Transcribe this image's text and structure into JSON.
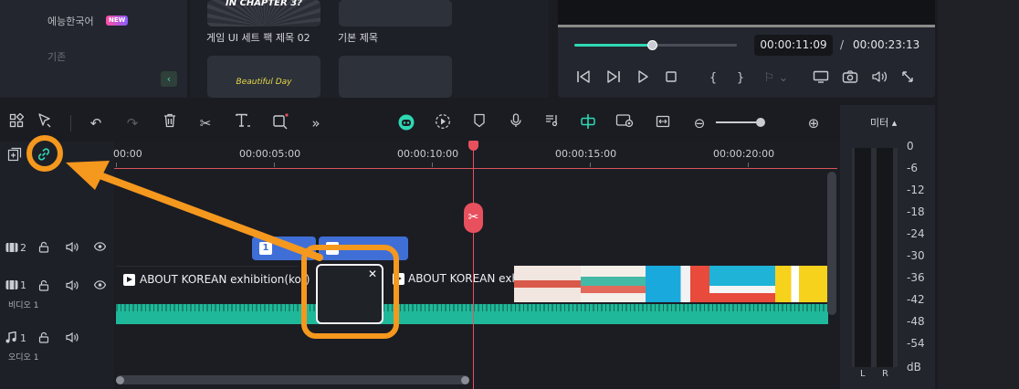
{
  "left_panel": {
    "items": [
      "에능한국어",
      "기존"
    ],
    "new_badge": "NEW",
    "collapse_icon": "chevron-left-icon"
  },
  "media_panel": {
    "thumbs": [
      {
        "title": "IN CHAPTER 3?",
        "label": "게임 UI 세트 팩 제목 02"
      },
      {
        "title": "",
        "label": "기본 제목"
      },
      {
        "title": "Beautiful Day",
        "label": ""
      },
      {
        "title": "",
        "label": ""
      }
    ]
  },
  "preview": {
    "current_time": "00:00:11:09",
    "separator": "/",
    "total_time": "00:00:23:13",
    "progress": 0.48,
    "controls": [
      "prev-frame-icon",
      "next-frame-icon",
      "play-icon",
      "stop-icon",
      "mark-in-icon",
      "mark-out-icon",
      "quality-icon",
      "display-icon",
      "snapshot-icon",
      "volume-icon",
      "fullscreen-icon"
    ]
  },
  "toolbar": {
    "icons": [
      "layout-icon",
      "select-pointer-icon",
      "undo-icon",
      "redo-icon",
      "delete-icon",
      "cut-icon",
      "text-icon",
      "crop-icon",
      "more-icon",
      "ai-robot-icon",
      "render-preview-icon",
      "marker-icon",
      "microphone-icon",
      "audio-stretch-icon",
      "ripple-split-icon",
      "screen-record-icon",
      "fit-icon",
      "zoom-out-icon",
      "zoom-in-icon"
    ],
    "zoom_level": 0.9
  },
  "timeline": {
    "ruler": [
      "00:00",
      "00:00:05:00",
      "00:00:10:00",
      "00:00:15:00",
      "00:00:20:00"
    ],
    "tracks": {
      "title": {
        "num": "2"
      },
      "video": {
        "num": "1",
        "name": "비디오 1"
      },
      "audio": {
        "num": "1",
        "name": "오디오 1"
      }
    },
    "clips": {
      "video1": "ABOUT KOREAN exhibition(kor)",
      "video2": "ABOUT KOREAN exhib",
      "title1": "1",
      "title2": ""
    },
    "gap_close": "✕"
  },
  "meter": {
    "title": "미터 ▴",
    "levels": [
      "0",
      "-6",
      "-12",
      "-18",
      "-24",
      "-30",
      "-36",
      "-42",
      "-48",
      "-54",
      "dB"
    ],
    "left": "L",
    "right": "R"
  },
  "colors": {
    "accent": "#2fd8b4",
    "playhead": "#e8505e",
    "highlight": "#f5981e",
    "title_clip": "#3f6fd6"
  }
}
